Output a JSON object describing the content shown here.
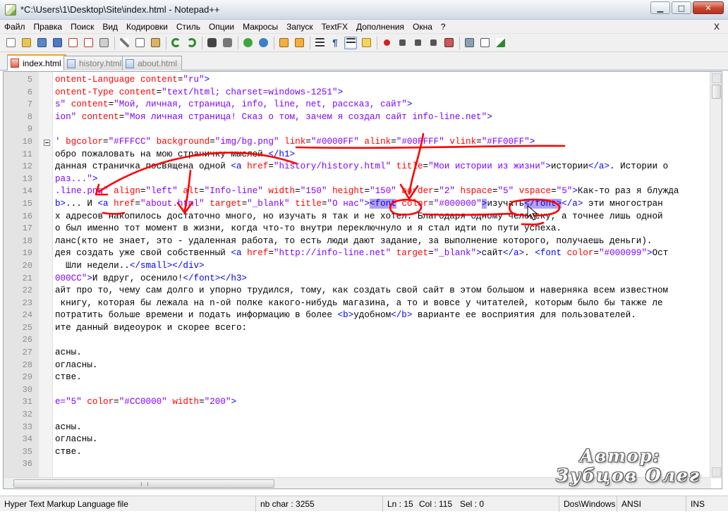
{
  "window": {
    "title": "*C:\\Users\\1\\Desktop\\Site\\index.html - Notepad++",
    "minimize": "▁",
    "maximize": "□",
    "close": "✕"
  },
  "menu": {
    "items": [
      "Файл",
      "Правка",
      "Поиск",
      "Вид",
      "Кодировки",
      "Стиль",
      "Опции",
      "Макросы",
      "Запуск",
      "TextFX",
      "Дополнения",
      "Окна",
      "?"
    ],
    "close_doc": "X"
  },
  "toolbar": {
    "buttons": [
      "new-file-icon",
      "open-file-icon",
      "save-icon",
      "save-all-icon",
      "close-icon",
      "close-all-icon",
      "print-icon",
      "cut-icon",
      "copy-icon",
      "paste-icon",
      "undo-icon",
      "redo-icon",
      "find-icon",
      "replace-icon",
      "zoom-in-icon",
      "zoom-out-icon",
      "sync-v-icon",
      "sync-h-icon",
      "wrap-icon",
      "show-all-icon",
      "indent-guide-icon",
      "fold-icon",
      "record-icon",
      "stop-icon",
      "play-icon",
      "play-multi-icon",
      "save-macro-icon",
      "run-icon",
      "console-icon",
      "spellcheck-icon"
    ]
  },
  "tabs": [
    {
      "label": "index.html",
      "active": true
    },
    {
      "label": "history.html",
      "active": false
    },
    {
      "label": "about.html",
      "active": false
    }
  ],
  "editor": {
    "lines": [
      {
        "n": "5",
        "fold": false,
        "segs": [
          [
            "at",
            "ontent-Language"
          ],
          [
            "t",
            " "
          ],
          [
            "at",
            "content"
          ],
          [
            "t",
            "="
          ],
          [
            "st",
            "\"ru\""
          ],
          [
            "tag",
            ">"
          ]
        ]
      },
      {
        "n": "6",
        "fold": false,
        "segs": [
          [
            "at",
            "ontent-Type"
          ],
          [
            "t",
            " "
          ],
          [
            "at",
            "content"
          ],
          [
            "t",
            "="
          ],
          [
            "st",
            "\"text/html; charset=windows-1251\""
          ],
          [
            "tag",
            ">"
          ]
        ]
      },
      {
        "n": "7",
        "fold": false,
        "segs": [
          [
            "st",
            "s\""
          ],
          [
            "t",
            " "
          ],
          [
            "at",
            "content"
          ],
          [
            "t",
            "="
          ],
          [
            "st",
            "\"Мой, личная, страница, info, line, net, рассказ, сайт\""
          ],
          [
            "tag",
            ">"
          ]
        ]
      },
      {
        "n": "8",
        "fold": false,
        "segs": [
          [
            "st",
            "ion\""
          ],
          [
            "t",
            " "
          ],
          [
            "at",
            "content"
          ],
          [
            "t",
            "="
          ],
          [
            "st",
            "\"Моя личная страница! Сказ о том, зачем я создал сайт info-line.net\""
          ],
          [
            "tag",
            ">"
          ]
        ]
      },
      {
        "n": "9",
        "fold": false,
        "segs": [
          [
            "t",
            ""
          ]
        ]
      },
      {
        "n": "10",
        "fold": true,
        "segs": [
          [
            "st",
            "'"
          ],
          [
            "t",
            " "
          ],
          [
            "at",
            "bgcolor"
          ],
          [
            "t",
            "="
          ],
          [
            "st",
            "\"#FFFCC\""
          ],
          [
            "t",
            " "
          ],
          [
            "at",
            "background"
          ],
          [
            "t",
            "="
          ],
          [
            "st",
            "\"img/bg.png\""
          ],
          [
            "t",
            " "
          ],
          [
            "at",
            "link"
          ],
          [
            "t",
            "="
          ],
          [
            "st",
            "\"#0000FF\""
          ],
          [
            "t",
            " "
          ],
          [
            "at",
            "alink"
          ],
          [
            "t",
            "="
          ],
          [
            "st",
            "\"#00FFFF\""
          ],
          [
            "t",
            " "
          ],
          [
            "at",
            "vlink"
          ],
          [
            "t",
            "="
          ],
          [
            "st",
            "\"#FF00FF\""
          ],
          [
            "tag",
            ">"
          ]
        ]
      },
      {
        "n": "11",
        "fold": false,
        "segs": [
          [
            "t",
            "обро пожаловать на мою страничку мыслей."
          ],
          [
            "tag",
            "</h1>"
          ]
        ]
      },
      {
        "n": "12",
        "fold": false,
        "segs": [
          [
            "t",
            "данная страничка посвящена одной "
          ],
          [
            "tag",
            "<a"
          ],
          [
            "t",
            " "
          ],
          [
            "at",
            "href"
          ],
          [
            "t",
            "="
          ],
          [
            "st",
            "\"history/history.html\""
          ],
          [
            "t",
            " "
          ],
          [
            "at",
            "title"
          ],
          [
            "t",
            "="
          ],
          [
            "st",
            "\"Мои истории из жизни\""
          ],
          [
            "tag",
            ">"
          ],
          [
            "t",
            "истории"
          ],
          [
            "tag",
            "</a>"
          ],
          [
            "t",
            ". Истории о"
          ]
        ]
      },
      {
        "n": "13",
        "fold": false,
        "segs": [
          [
            "st",
            "раз...\""
          ],
          [
            "tag",
            ">"
          ]
        ]
      },
      {
        "n": "14",
        "fold": false,
        "segs": [
          [
            "st",
            ".line.png\""
          ],
          [
            "t",
            " "
          ],
          [
            "at",
            "align"
          ],
          [
            "t",
            "="
          ],
          [
            "st",
            "\"left\""
          ],
          [
            "t",
            " "
          ],
          [
            "at",
            "alt"
          ],
          [
            "t",
            "="
          ],
          [
            "st",
            "\"Info-line\""
          ],
          [
            "t",
            " "
          ],
          [
            "at",
            "width"
          ],
          [
            "t",
            "="
          ],
          [
            "st",
            "\"150\""
          ],
          [
            "t",
            " "
          ],
          [
            "at",
            "height"
          ],
          [
            "t",
            "="
          ],
          [
            "st",
            "\"150\""
          ],
          [
            "t",
            " "
          ],
          [
            "at",
            "border"
          ],
          [
            "t",
            "="
          ],
          [
            "st",
            "\"2\""
          ],
          [
            "t",
            " "
          ],
          [
            "at",
            "hspace"
          ],
          [
            "t",
            "="
          ],
          [
            "st",
            "\"5\""
          ],
          [
            "t",
            " "
          ],
          [
            "at",
            "vspace"
          ],
          [
            "t",
            "="
          ],
          [
            "st",
            "\"5\""
          ],
          [
            "tag",
            ">"
          ],
          [
            "t",
            "Как-то раз я блужда"
          ]
        ]
      },
      {
        "n": "15",
        "fold": false,
        "segs": [
          [
            "tag",
            "b>"
          ],
          [
            "t",
            "... И "
          ],
          [
            "tag",
            "<a"
          ],
          [
            "t",
            " "
          ],
          [
            "at",
            "href"
          ],
          [
            "t",
            "="
          ],
          [
            "st",
            "\"about.html\""
          ],
          [
            "t",
            " "
          ],
          [
            "at",
            "target"
          ],
          [
            "t",
            "="
          ],
          [
            "st",
            "\"_blank\""
          ],
          [
            "t",
            " "
          ],
          [
            "at",
            "title"
          ],
          [
            "t",
            "="
          ],
          [
            "st",
            "\"О нас\""
          ],
          [
            "tag",
            ">"
          ],
          [
            "hltag",
            "<font"
          ],
          [
            "t",
            " "
          ],
          [
            "at",
            "color"
          ],
          [
            "t",
            "="
          ],
          [
            "st",
            "\"#000000\""
          ],
          [
            "hltag",
            ">"
          ],
          [
            "t",
            "изучать"
          ],
          [
            "hltag",
            "</font>"
          ],
          [
            "tag",
            "</a>"
          ],
          [
            "t",
            " эти многостран"
          ]
        ]
      },
      {
        "n": "16",
        "fold": false,
        "segs": [
          [
            "t",
            "х адресов накопилось достаточно много, но изучать я так и не хотел. Благодаря одному человеку, а точнее лишь одной"
          ]
        ]
      },
      {
        "n": "17",
        "fold": false,
        "segs": [
          [
            "t",
            "о был именно тот момент в жизни, когда что-то внутри переключнуло и я стал идти по пути успеха."
          ]
        ]
      },
      {
        "n": "18",
        "fold": false,
        "segs": [
          [
            "t",
            "ланс(кто не знает, это - удаленная работа, то есть люди дают задание, за выполнение которого, получаешь деньги)."
          ]
        ]
      },
      {
        "n": "19",
        "fold": false,
        "segs": [
          [
            "t",
            "дея создать уже свой собственный "
          ],
          [
            "tag",
            "<a"
          ],
          [
            "t",
            " "
          ],
          [
            "at",
            "href"
          ],
          [
            "t",
            "="
          ],
          [
            "st",
            "\"http://info-line.net\""
          ],
          [
            "t",
            " "
          ],
          [
            "at",
            "target"
          ],
          [
            "t",
            "="
          ],
          [
            "st",
            "\"_blank\""
          ],
          [
            "tag",
            ">"
          ],
          [
            "t",
            "сайт"
          ],
          [
            "tag",
            "</a>"
          ],
          [
            "t",
            ". "
          ],
          [
            "tag",
            "<font"
          ],
          [
            "t",
            " "
          ],
          [
            "at",
            "color"
          ],
          [
            "t",
            "="
          ],
          [
            "st",
            "\"#000099\""
          ],
          [
            "tag",
            ">"
          ],
          [
            "t",
            "Ост"
          ]
        ]
      },
      {
        "n": "20",
        "fold": false,
        "segs": [
          [
            "t",
            "  Шли недели.."
          ],
          [
            "tag",
            "</small></div>"
          ]
        ]
      },
      {
        "n": "21",
        "fold": false,
        "segs": [
          [
            "st",
            "000CC\""
          ],
          [
            "tag",
            ">"
          ],
          [
            "t",
            "И вдруг, осенило!"
          ],
          [
            "tag",
            "</font></h3>"
          ]
        ]
      },
      {
        "n": "22",
        "fold": false,
        "segs": [
          [
            "t",
            "айт про то, чему сам долго и упорно трудился, тому, как создать свой сайт в этом большом и наверняка всем известном"
          ]
        ]
      },
      {
        "n": "23",
        "fold": false,
        "segs": [
          [
            "t",
            " книгу, которая бы лежала на n-ой полке какого-нибудь магазина, а то и вовсе у читателей, которым было бы также ле"
          ]
        ]
      },
      {
        "n": "24",
        "fold": false,
        "segs": [
          [
            "t",
            "потратить больше времени и подать информацию в более "
          ],
          [
            "tag",
            "<b>"
          ],
          [
            "t",
            "удобном"
          ],
          [
            "tag",
            "</b>"
          ],
          [
            "t",
            " варианте ее восприятия для пользователей."
          ]
        ]
      },
      {
        "n": "25",
        "fold": false,
        "segs": [
          [
            "t",
            "ите данный видеоурок и скорее всего:"
          ]
        ]
      },
      {
        "n": "26",
        "fold": false,
        "segs": [
          [
            "t",
            ""
          ]
        ]
      },
      {
        "n": "27",
        "fold": false,
        "segs": [
          [
            "t",
            "асны."
          ]
        ]
      },
      {
        "n": "28",
        "fold": false,
        "segs": [
          [
            "t",
            "огласны."
          ]
        ]
      },
      {
        "n": "29",
        "fold": false,
        "segs": [
          [
            "t",
            "стве."
          ]
        ]
      },
      {
        "n": "30",
        "fold": false,
        "segs": [
          [
            "t",
            ""
          ]
        ]
      },
      {
        "n": "31",
        "fold": false,
        "segs": [
          [
            "st",
            "e=\"5\""
          ],
          [
            "t",
            " "
          ],
          [
            "at",
            "color"
          ],
          [
            "t",
            "="
          ],
          [
            "st",
            "\"#CC0000\""
          ],
          [
            "t",
            " "
          ],
          [
            "at",
            "width"
          ],
          [
            "t",
            "="
          ],
          [
            "st",
            "\"200\""
          ],
          [
            "tag",
            ">"
          ]
        ]
      },
      {
        "n": "32",
        "fold": false,
        "segs": [
          [
            "t",
            ""
          ]
        ]
      },
      {
        "n": "33",
        "fold": false,
        "segs": [
          [
            "t",
            "асны."
          ]
        ]
      },
      {
        "n": "34",
        "fold": false,
        "segs": [
          [
            "t",
            "огласны."
          ]
        ]
      },
      {
        "n": "35",
        "fold": false,
        "segs": [
          [
            "t",
            "стве."
          ]
        ]
      },
      {
        "n": "36",
        "fold": false,
        "segs": [
          [
            "t",
            ""
          ]
        ]
      }
    ]
  },
  "statusbar": {
    "file_type": "Hyper Text Markup Language file",
    "nb_char": "nb char : 3255",
    "ln": "Ln : 15",
    "col": "Col : 115",
    "sel": "Sel : 0",
    "eol": "Dos\\Windows",
    "encoding": "ANSI",
    "mode": "INS"
  },
  "watermark": {
    "line1": "Автор:",
    "line2": "Зубцов Олег"
  },
  "colors": {
    "tag": "#0000ff",
    "attribute": "#ff0000",
    "string": "#8000ff",
    "annotation": "#ff0000",
    "active_tab_accent": "#f7a21b"
  }
}
